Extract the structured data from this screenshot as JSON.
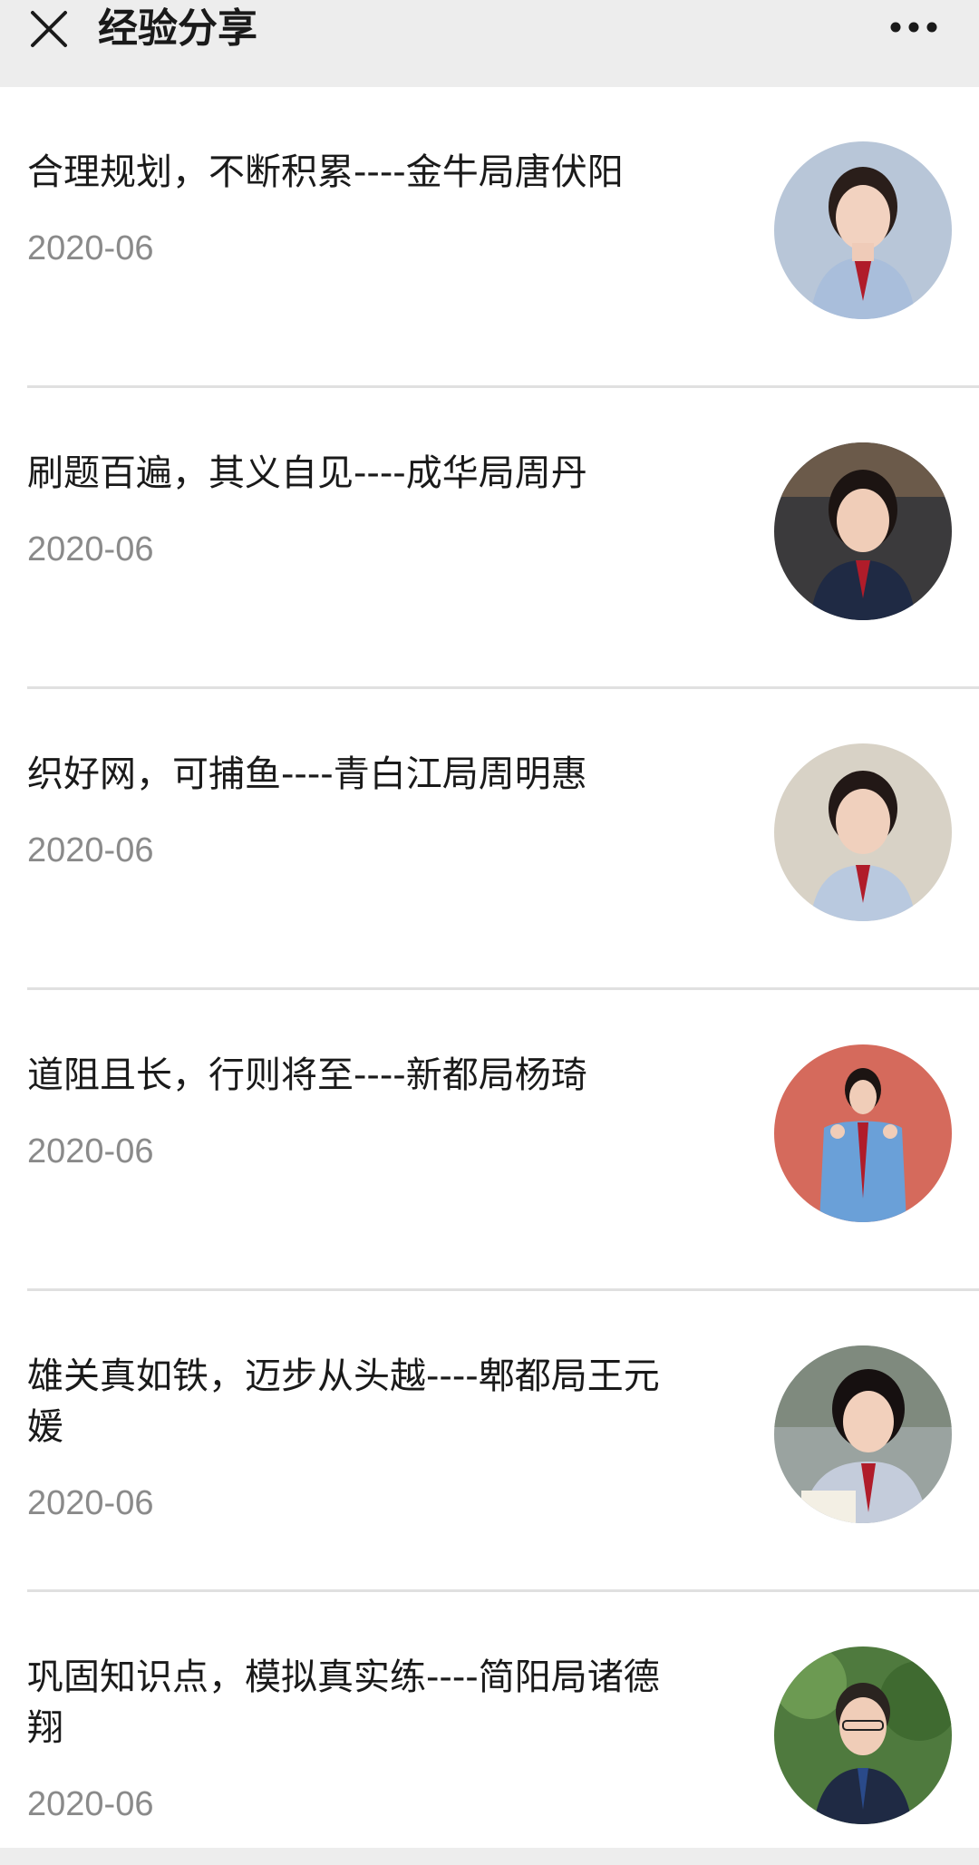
{
  "header": {
    "title": "经验分享"
  },
  "articles": [
    {
      "title": "合理规划，不断积累----金牛局唐伏阳",
      "date": "2020-06",
      "avatar_bg": "#b8c6d8"
    },
    {
      "title": "刷题百遍，其义自见----成华局周丹",
      "date": "2020-06",
      "avatar_bg": "#3b3a3c"
    },
    {
      "title": "织好网，可捕鱼----青白江局周明惠",
      "date": "2020-06",
      "avatar_bg": "#d8d2c6"
    },
    {
      "title": "道阻且长，行则将至----新都局杨琦",
      "date": "2020-06",
      "avatar_bg": "#d56a5c"
    },
    {
      "title": "雄关真如铁，迈步从头越----郫都局王元媛",
      "date": "2020-06",
      "avatar_bg": "#9aa3a0"
    },
    {
      "title": "巩固知识点，模拟真实练----简阳局诸德翔",
      "date": "2020-06",
      "avatar_bg": "#4f7a3e"
    }
  ],
  "icons": {
    "close": "close-icon",
    "more": "more-icon"
  }
}
